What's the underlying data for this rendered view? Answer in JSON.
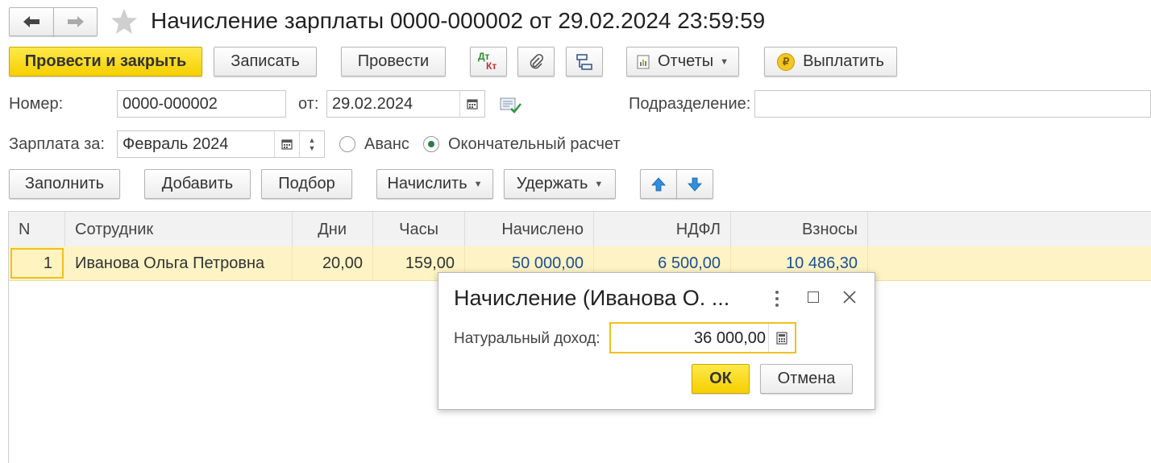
{
  "title": "Начисление зарплаты 0000-000002 от 29.02.2024 23:59:59",
  "toolbar": {
    "post_close": "Провести и закрыть",
    "save": "Записать",
    "post": "Провести",
    "dtkt_top": "Дт",
    "dtkt_bottom": "Кт",
    "reports": "Отчеты",
    "pay": "Выплатить"
  },
  "header": {
    "number_label": "Номер:",
    "number_value": "0000-000002",
    "date_label": "от:",
    "date_value": "29.02.2024",
    "department_label": "Подразделение:",
    "department_value": "",
    "salary_for_label": "Зарплата за:",
    "salary_for_value": "Февраль 2024",
    "radio_advance": "Аванс",
    "radio_final": "Окончательный расчет"
  },
  "table_toolbar": {
    "fill": "Заполнить",
    "add": "Добавить",
    "select": "Подбор",
    "accrue": "Начислить",
    "withhold": "Удержать"
  },
  "table": {
    "columns": [
      "N",
      "Сотрудник",
      "Дни",
      "Часы",
      "Начислено",
      "НДФЛ",
      "Взносы"
    ],
    "rows": [
      {
        "n": "1",
        "employee": "Иванова Ольга Петровна",
        "days": "20,00",
        "hours": "159,00",
        "accrued": "50 000,00",
        "ndfl": "6 500,00",
        "contributions": "10 486,30"
      }
    ]
  },
  "dialog": {
    "title": "Начисление (Иванова О. ...",
    "field_label": "Натуральный доход:",
    "field_value": "36 000,00",
    "ok": "ОК",
    "cancel": "Отмена"
  },
  "colors": {
    "accent_yellow": "#f5cf00",
    "link_blue": "#1c4f96",
    "row_highlight": "#fdf3c4"
  }
}
